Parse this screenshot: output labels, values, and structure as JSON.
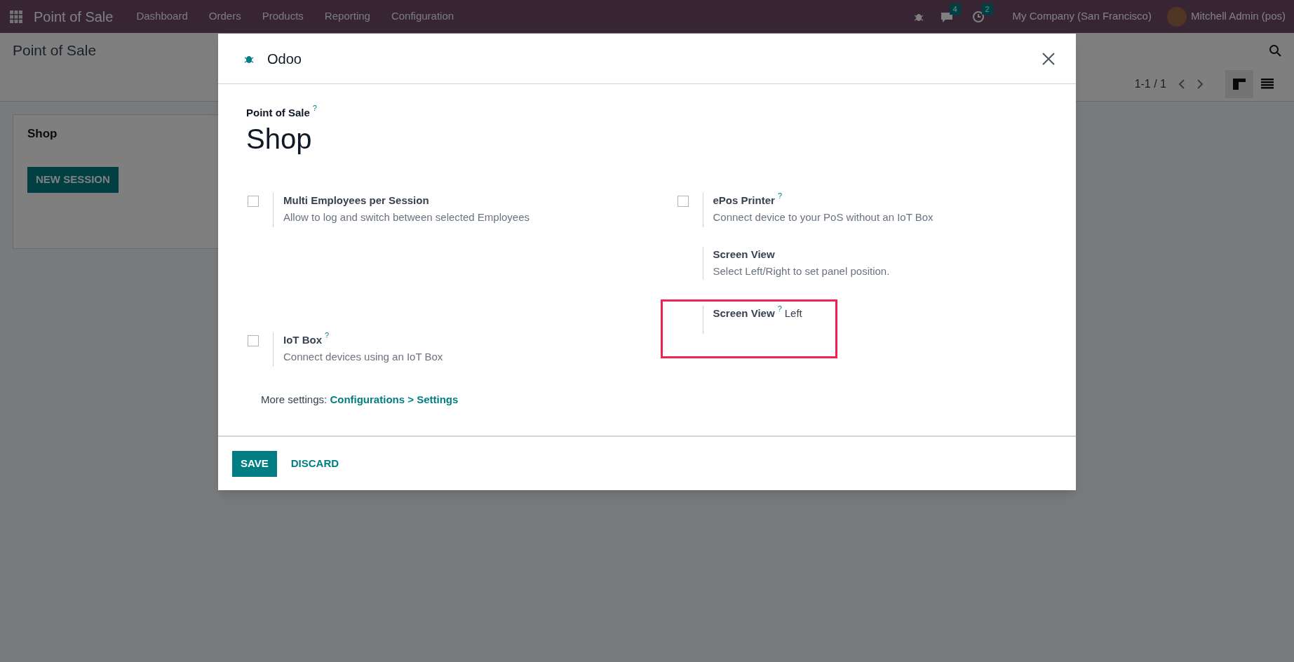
{
  "navbar": {
    "app_name": "Point of Sale",
    "menu": [
      "Dashboard",
      "Orders",
      "Products",
      "Reporting",
      "Configuration"
    ],
    "chat_count": "4",
    "activity_count": "2",
    "company": "My Company (San Francisco)",
    "user": "Mitchell Admin (pos)"
  },
  "control_panel": {
    "breadcrumb": "Point of Sale",
    "pager": "1-1 / 1",
    "views": [
      {
        "kind": "kanban",
        "selected": true
      },
      {
        "kind": "list",
        "selected": false
      }
    ]
  },
  "kanban_card": {
    "title": "Shop",
    "button": "NEW SESSION"
  },
  "dialog": {
    "title": "Odoo",
    "field_label": "Point of Sale",
    "help_mark": "?",
    "record_name": "Shop",
    "left": [
      {
        "kind": "checkbox",
        "title": "Multi Employees per Session",
        "checked": false,
        "description": "Allow to log and switch between selected Employees"
      },
      {
        "kind": "checkbox",
        "title": "IoT Box",
        "help_mark": "?",
        "checked": false,
        "description": "Connect devices using an IoT Box"
      }
    ],
    "right": [
      {
        "kind": "checkbox",
        "title": "ePos Printer",
        "help_mark": "?",
        "checked": false,
        "description": "Connect device to your PoS without an IoT Box"
      },
      {
        "kind": "info",
        "title": "Screen View",
        "description": "Select Left/Right to set panel position."
      },
      {
        "kind": "field",
        "title": "Screen View",
        "help_mark": "?",
        "value": "Left",
        "highlighted": true
      }
    ],
    "more_settings_label": "More settings:",
    "more_settings_link": "Configurations > Settings",
    "buttons": [
      {
        "label": "SAVE",
        "kind": "primary"
      },
      {
        "label": "DISCARD",
        "kind": "secondary"
      }
    ]
  }
}
